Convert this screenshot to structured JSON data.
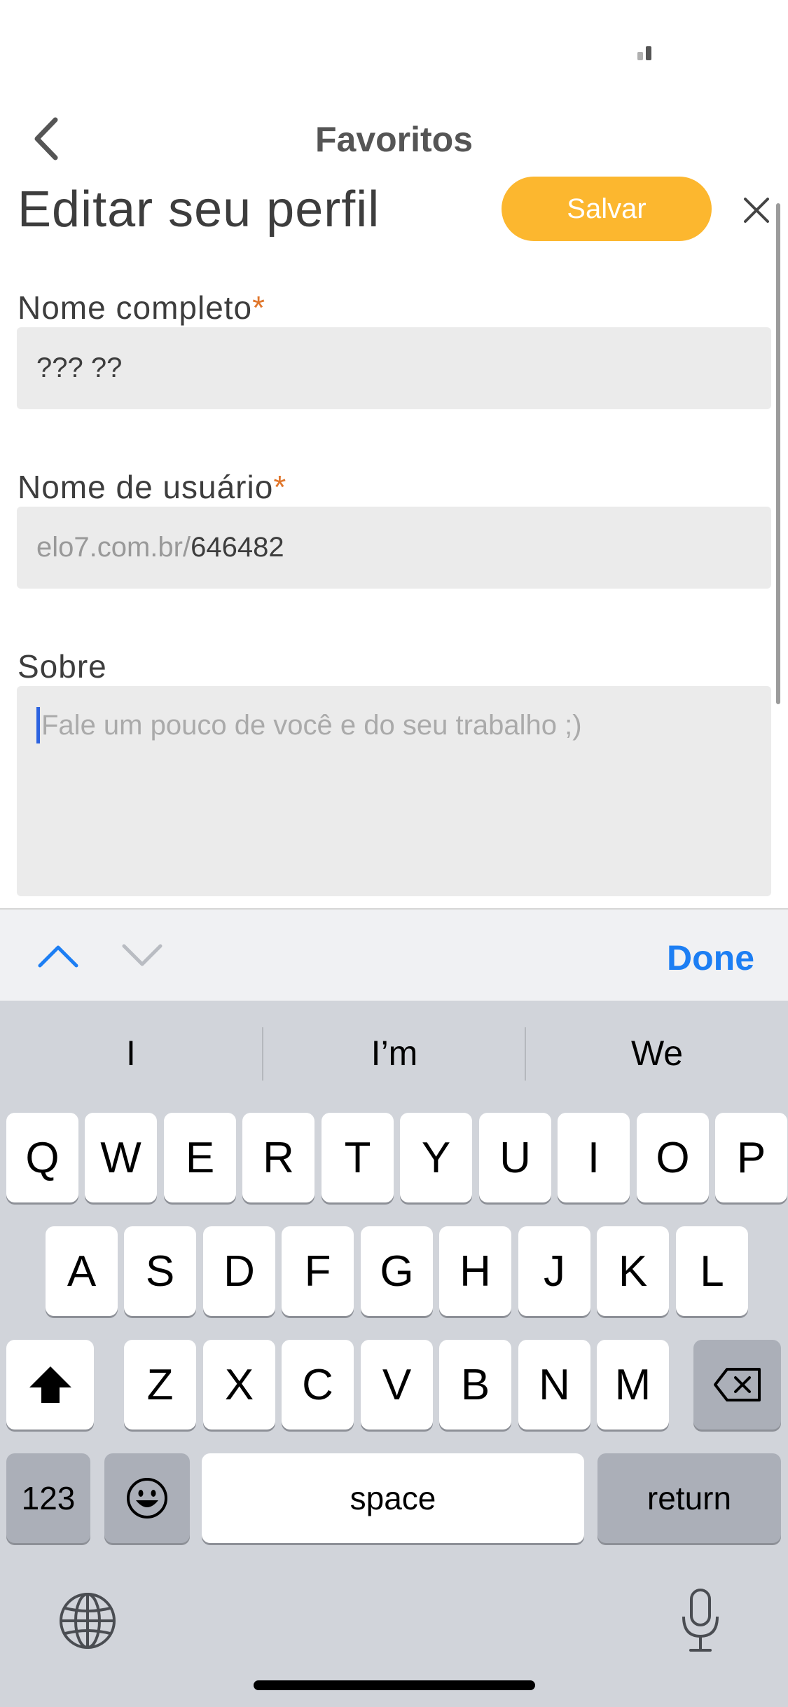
{
  "nav": {
    "title": "Favoritos",
    "back_icon": "chevron-left-icon"
  },
  "header": {
    "title": "Editar seu perfil",
    "save_label": "Salvar",
    "close_icon": "close-icon"
  },
  "form": {
    "full_name": {
      "label": "Nome completo",
      "required_mark": "*",
      "value": "??? ??"
    },
    "username": {
      "label": "Nome de usuário",
      "required_mark": "*",
      "prefix": "elo7.com.br/",
      "value": "646482"
    },
    "about": {
      "label": "Sobre",
      "placeholder": "Fale um pouco de você e do seu trabalho ;)",
      "value": ""
    }
  },
  "accessory": {
    "prev_icon": "chevron-up-icon",
    "next_icon": "chevron-down-icon",
    "done_label": "Done"
  },
  "keyboard": {
    "suggestions": [
      "I",
      "I’m",
      "We"
    ],
    "row1": [
      "Q",
      "W",
      "E",
      "R",
      "T",
      "Y",
      "U",
      "I",
      "O",
      "P"
    ],
    "row2": [
      "A",
      "S",
      "D",
      "F",
      "G",
      "H",
      "J",
      "K",
      "L"
    ],
    "row3": [
      "Z",
      "X",
      "C",
      "V",
      "B",
      "N",
      "M"
    ],
    "numbers_label": "123",
    "space_label": "space",
    "return_label": "return",
    "icons": [
      "shift-icon",
      "backspace-icon",
      "emoji-icon",
      "globe-icon",
      "microphone-icon"
    ]
  },
  "colors": {
    "accent": "#fcb72f",
    "required": "#e0762b",
    "link_blue": "#1c7ef3",
    "field_bg": "#ebebeb",
    "keyboard_bg": "#d1d4da"
  }
}
